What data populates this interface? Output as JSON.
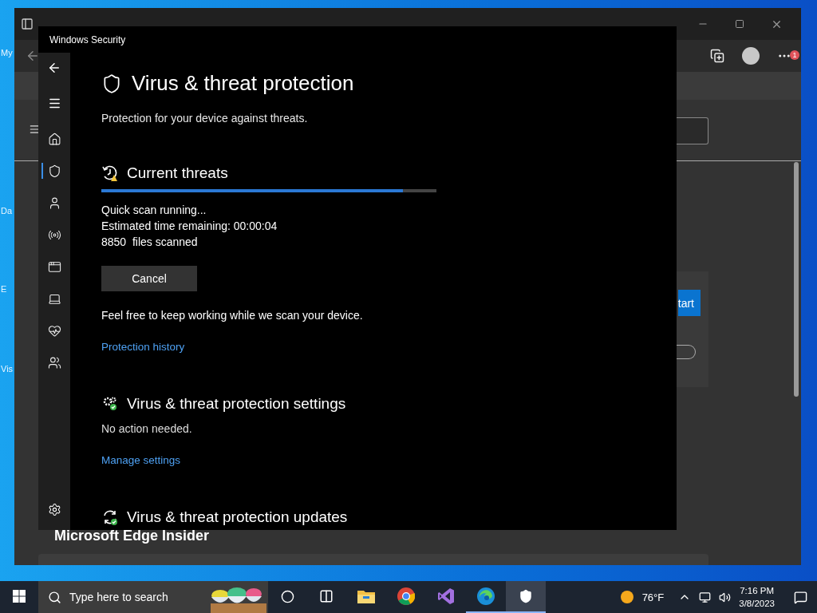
{
  "desktop": {
    "icons": [
      {
        "label": "My"
      },
      {
        "label": "Da"
      },
      {
        "label": "E"
      },
      {
        "label": "Vis"
      }
    ]
  },
  "browser": {
    "notification_badge": "1",
    "start_button": "tart",
    "toggle": {
      "on": false
    },
    "heading": "Microsoft Edge Insider"
  },
  "security": {
    "title": "Windows Security",
    "nav": [
      {
        "kind": "home",
        "selected": false
      },
      {
        "kind": "shield",
        "selected": true
      },
      {
        "kind": "account",
        "selected": false
      },
      {
        "kind": "network",
        "selected": false
      },
      {
        "kind": "app",
        "selected": false
      },
      {
        "kind": "device",
        "selected": false
      },
      {
        "kind": "health",
        "selected": false
      },
      {
        "kind": "family",
        "selected": false
      }
    ],
    "page_title": "Virus & threat protection",
    "page_subtitle": "Protection for your device against threats.",
    "current_threats": {
      "title": "Current threats",
      "level": 0.9,
      "lines": [
        "Quick scan running...",
        "Estimated time remaining: 00:00:04",
        "8850  files scanned"
      ],
      "cancel_button": "Cancel",
      "note": "Feel free to keep working while we scan your device.",
      "link": "Protection history"
    },
    "settings_section": {
      "title": "Virus & threat protection settings",
      "status": "No action needed.",
      "link": "Manage settings"
    },
    "updates_section": {
      "title": "Virus & threat protection updates"
    }
  },
  "taskbar": {
    "search_placeholder": "Type here to search",
    "apps": [
      {
        "kind": "cortana",
        "selected": false,
        "running": false
      },
      {
        "kind": "taskview",
        "selected": false,
        "running": false
      },
      {
        "kind": "explorer",
        "selected": false,
        "running": false
      },
      {
        "kind": "chrome",
        "selected": false,
        "running": false
      },
      {
        "kind": "visualstudio",
        "selected": false,
        "running": false
      },
      {
        "kind": "edge",
        "selected": false,
        "running": true
      },
      {
        "kind": "security",
        "selected": true,
        "running": true
      }
    ],
    "weather": "76°F",
    "time": "7:16 PM",
    "date": "3/8/2023"
  }
}
